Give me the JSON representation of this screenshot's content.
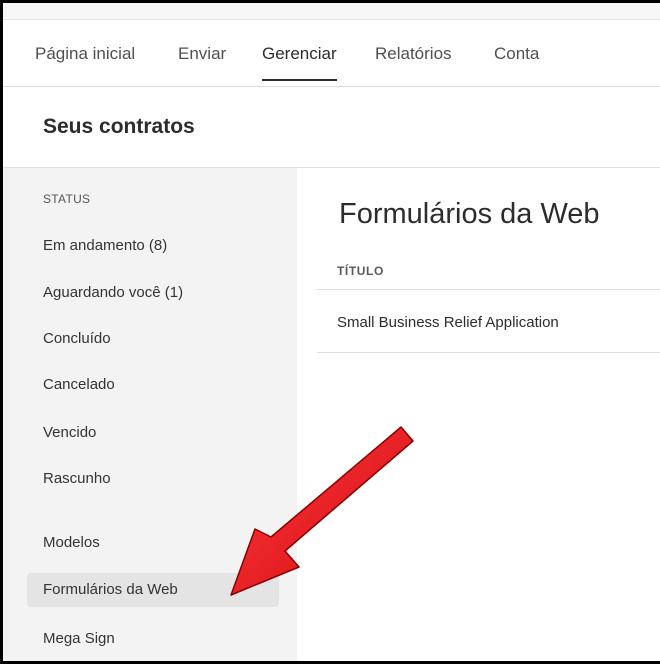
{
  "nav": {
    "tabs": [
      {
        "label": "Página inicial"
      },
      {
        "label": "Enviar"
      },
      {
        "label": "Gerenciar",
        "active": true
      },
      {
        "label": "Relatórios"
      },
      {
        "label": "Conta"
      }
    ]
  },
  "header": {
    "title": "Seus contratos"
  },
  "sidebar": {
    "section_label": "STATUS",
    "status_items": [
      {
        "label": "Em andamento (8)"
      },
      {
        "label": "Aguardando você (1)"
      },
      {
        "label": "Concluído"
      },
      {
        "label": "Cancelado"
      },
      {
        "label": "Vencido"
      },
      {
        "label": "Rascunho"
      }
    ],
    "other_items": [
      {
        "label": "Modelos"
      },
      {
        "label": "Formulários da Web",
        "selected": true
      },
      {
        "label": "Mega Sign"
      }
    ]
  },
  "main": {
    "title": "Formulários da Web",
    "column_header": "TÍTULO",
    "rows": [
      {
        "title": "Small Business Relief Application"
      }
    ]
  },
  "annotation": {
    "arrow_color": "#e8141b"
  }
}
